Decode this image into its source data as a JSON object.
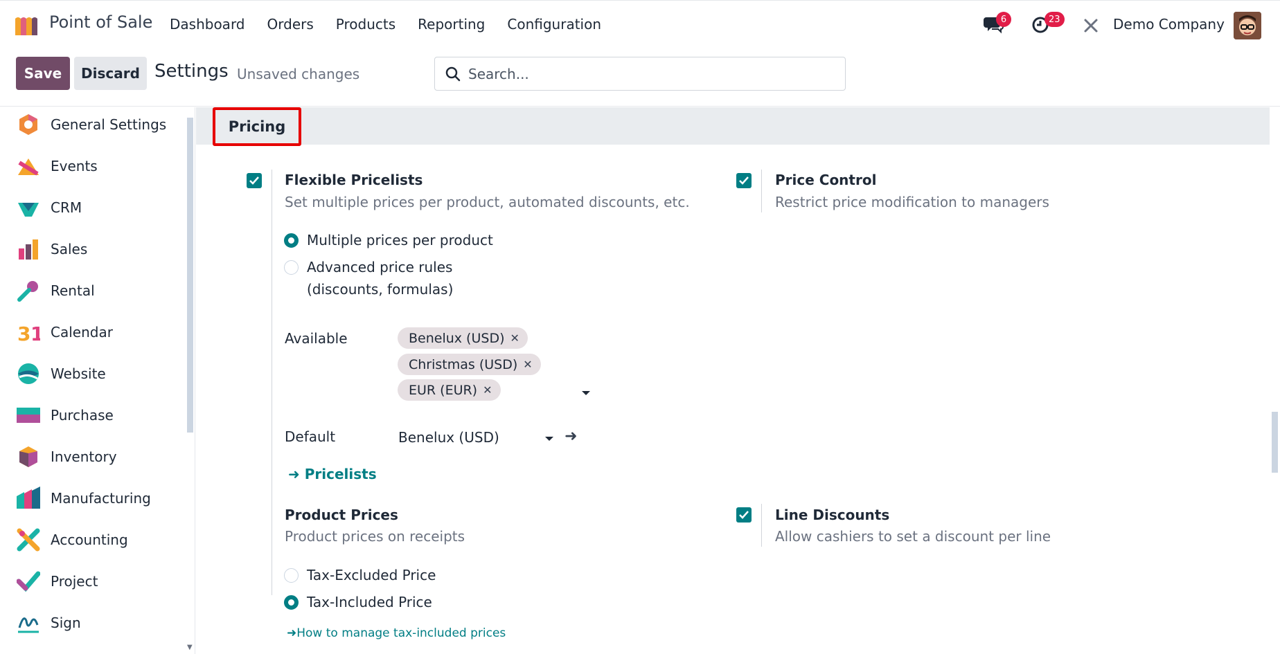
{
  "app": {
    "name": "Point of Sale"
  },
  "menu": {
    "items": [
      "Dashboard",
      "Orders",
      "Products",
      "Reporting",
      "Configuration"
    ]
  },
  "nav": {
    "messages_count": "6",
    "activities_count": "23",
    "company": "Demo Company",
    "icons": [
      "chat-icon",
      "clock-icon",
      "tools-icon"
    ]
  },
  "control": {
    "save_label": "Save",
    "discard_label": "Discard",
    "title": "Settings",
    "status": "Unsaved changes",
    "search_placeholder": "Search..."
  },
  "sidebar": {
    "items": [
      {
        "label": "General Settings",
        "icon": "general-settings-icon"
      },
      {
        "label": "Events",
        "icon": "events-icon"
      },
      {
        "label": "CRM",
        "icon": "crm-icon"
      },
      {
        "label": "Sales",
        "icon": "sales-icon"
      },
      {
        "label": "Rental",
        "icon": "rental-icon"
      },
      {
        "label": "Calendar",
        "icon": "calendar-icon"
      },
      {
        "label": "Website",
        "icon": "website-icon"
      },
      {
        "label": "Purchase",
        "icon": "purchase-icon"
      },
      {
        "label": "Inventory",
        "icon": "inventory-icon"
      },
      {
        "label": "Manufacturing",
        "icon": "manufacturing-icon"
      },
      {
        "label": "Accounting",
        "icon": "accounting-icon"
      },
      {
        "label": "Project",
        "icon": "project-icon"
      },
      {
        "label": "Sign",
        "icon": "sign-icon"
      }
    ]
  },
  "section": {
    "title": "Pricing"
  },
  "flexible_pricelists": {
    "title": "Flexible Pricelists",
    "desc": "Set multiple prices per product, automated discounts, etc.",
    "checked": true,
    "options": [
      "Multiple prices per product",
      "Advanced price rules",
      "(discounts, formulas)"
    ],
    "selected": "Multiple prices per product",
    "available_label": "Available",
    "available_tags": [
      "Benelux (USD)",
      "Christmas (USD)",
      "EUR (EUR)"
    ],
    "default_label": "Default",
    "default_value": "Benelux (USD)",
    "link_label": "Pricelists"
  },
  "price_control": {
    "title": "Price Control",
    "desc": "Restrict price modification to managers",
    "checked": true
  },
  "product_prices": {
    "title": "Product Prices",
    "desc": "Product prices on receipts",
    "options": [
      "Tax-Excluded Price",
      "Tax-Included Price"
    ],
    "selected": "Tax-Included Price",
    "link_label": "How to manage tax-included prices"
  },
  "line_discounts": {
    "title": "Line Discounts",
    "desc": "Allow cashiers to set a discount per line",
    "checked": true
  },
  "colors": {
    "primary": "#714b67",
    "accent": "#017e84",
    "badge": "#e11d48",
    "highlight_border": "#e60000"
  }
}
